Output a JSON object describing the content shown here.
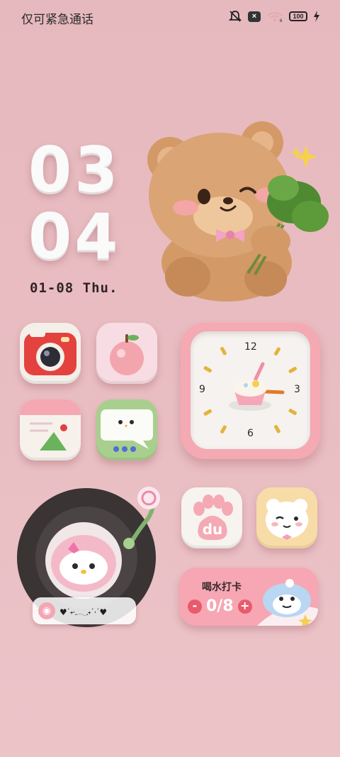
{
  "status_bar": {
    "carrier_text": "仅可紧急通话",
    "battery_level": "100",
    "icons": [
      "mute-bell-icon",
      "sim-x-icon",
      "wifi-icon",
      "battery-icon",
      "charging-bolt-icon"
    ]
  },
  "clock": {
    "hours": "03",
    "minutes": "04",
    "date": "01-08  Thu."
  },
  "analog_clock": {
    "numerals": {
      "twelve": "12",
      "three": "3",
      "six": "6",
      "nine": "9"
    }
  },
  "apps": [
    {
      "name": "camera",
      "icon": "camera-icon"
    },
    {
      "name": "apple",
      "icon": "apple-icon"
    },
    {
      "name": "calendar",
      "icon": "calendar-icon"
    },
    {
      "name": "messages",
      "icon": "chat-bird-icon"
    },
    {
      "name": "baidu",
      "icon": "paw-du-icon",
      "label_text": "du"
    },
    {
      "name": "bear-face",
      "icon": "white-bear-icon"
    }
  ],
  "music_widget": {
    "now_playing": "♥˙˖·.𓂃.˖˙·˙♥"
  },
  "water_widget": {
    "title": "喝水打卡",
    "count": "0/8",
    "minus": "-",
    "plus": "+"
  },
  "colors": {
    "background": "#e8bcc1",
    "accent_pink": "#f6a7b3",
    "accent_red": "#e85a6c"
  }
}
